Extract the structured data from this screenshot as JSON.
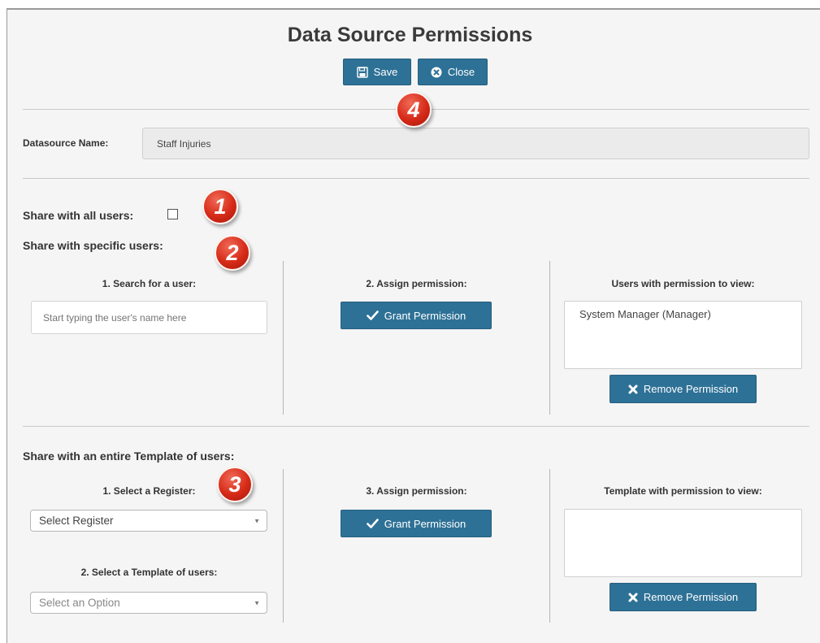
{
  "dialog": {
    "title": "Data Source Permissions",
    "save_label": "Save",
    "close_label": "Close"
  },
  "datasource": {
    "label": "Datasource Name:",
    "value": "Staff Injuries"
  },
  "share_all": {
    "label": "Share with all users:",
    "checked": false
  },
  "specific_users": {
    "heading": "Share with specific users:",
    "search_label": "1. Search for a user:",
    "search_placeholder": "Start typing the user's name here",
    "assign_label": "2. Assign permission:",
    "grant_label": "Grant Permission",
    "list_label": "Users with permission to view:",
    "list_items": [
      "System Manager (Manager)"
    ],
    "remove_label": "Remove Permission"
  },
  "template_users": {
    "heading": "Share with an entire Template of users:",
    "register_label": "1. Select a Register:",
    "register_value": "Select Register",
    "template_label": "2. Select a Template of users:",
    "template_value": "Select an Option",
    "assign_label": "3. Assign permission:",
    "grant_label": "Grant Permission",
    "list_label": "Template with permission to view:",
    "remove_label": "Remove Permission"
  },
  "badges": [
    "1",
    "2",
    "3",
    "4"
  ],
  "colors": {
    "button": "#2e7196",
    "badge": "#d62a18",
    "panel": "#f5f5f5"
  }
}
